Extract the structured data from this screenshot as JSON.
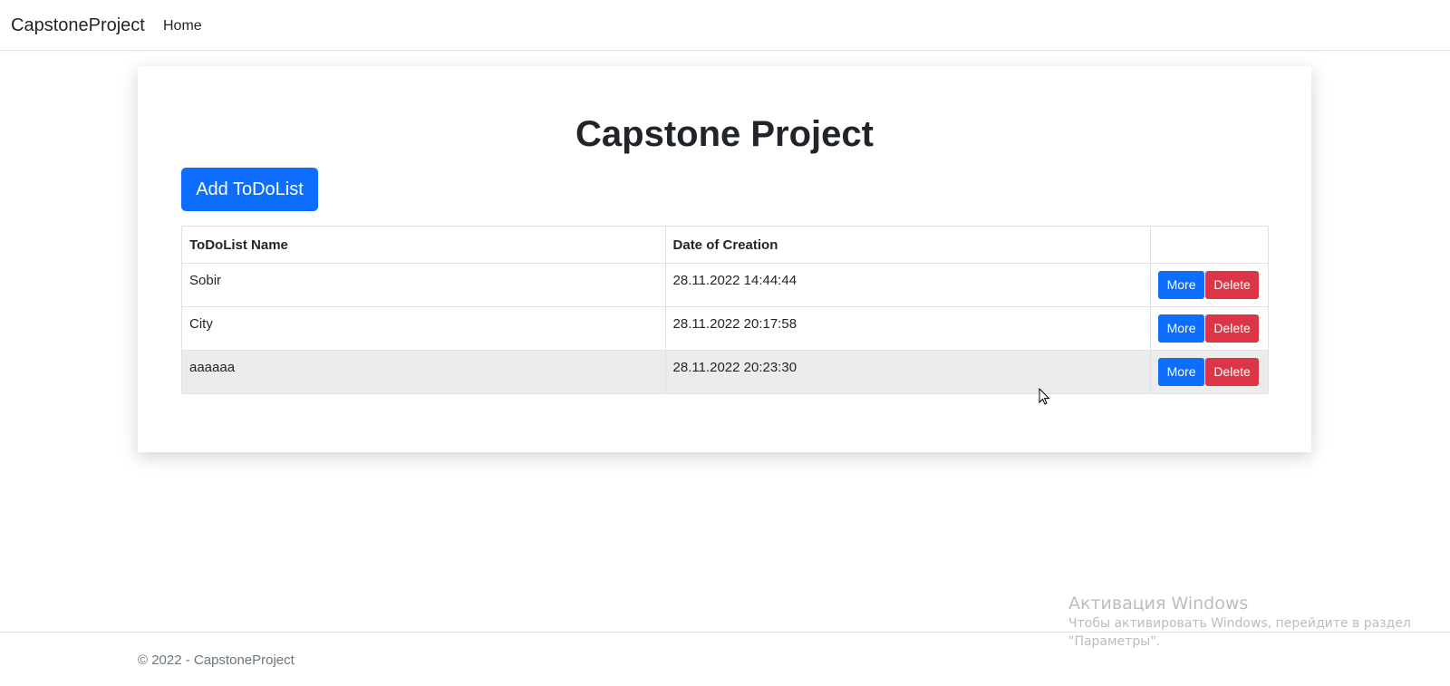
{
  "nav": {
    "brand": "CapstoneProject",
    "home": "Home"
  },
  "main": {
    "title": "Capstone Project",
    "add_button": "Add ToDoList",
    "table": {
      "headers": [
        "ToDoList Name",
        "Date of Creation",
        ""
      ],
      "rows": [
        {
          "name": "Sobir",
          "date": "28.11.2022 14:44:44"
        },
        {
          "name": "City",
          "date": "28.11.2022 20:17:58"
        },
        {
          "name": "aaaaaa",
          "date": "28.11.2022 20:23:30"
        }
      ],
      "more_label": "More",
      "delete_label": "Delete"
    }
  },
  "footer": {
    "text": "© 2022 - CapstoneProject"
  },
  "watermark": {
    "title": "Активация Windows",
    "line1": "Чтобы активировать Windows, перейдите в раздел",
    "line2": "\"Параметры\"."
  },
  "colors": {
    "primary": "#0d6efd",
    "danger": "#dc3545",
    "hover_row": "#ececec"
  }
}
